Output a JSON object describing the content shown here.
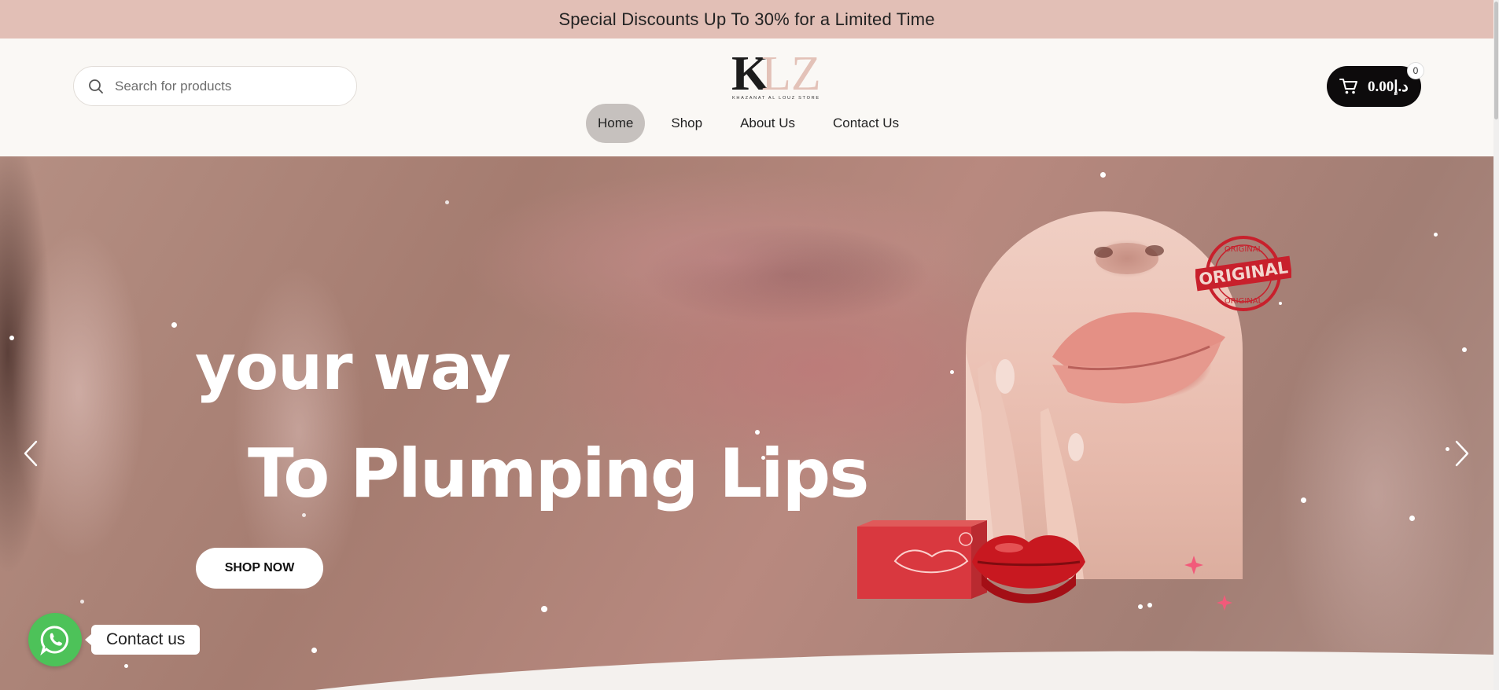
{
  "promo": {
    "text": "Special Discounts Up To 30% for a Limited Time"
  },
  "header": {
    "search_placeholder": "Search for products",
    "logo_text": "KLZ",
    "logo_tagline": "KHAZANAT AL LOUZ STORE",
    "nav": [
      {
        "label": "Home",
        "active": true
      },
      {
        "label": "Shop",
        "active": false
      },
      {
        "label": "About Us",
        "active": false
      },
      {
        "label": "Contact Us",
        "active": false
      }
    ],
    "cart": {
      "amount": "0.00د.إ",
      "count": "0"
    }
  },
  "hero": {
    "line1": "your way",
    "line2": "To Plumping Lips",
    "cta": "SHOP NOW",
    "stamp_text": "ORIGINAL",
    "icons": {
      "prev": "chevron-left-icon",
      "next": "chevron-right-icon"
    }
  },
  "widget": {
    "contact_label": "Contact us",
    "icon": "whatsapp-icon"
  },
  "colors": {
    "promo_bg": "#e2bfb6",
    "cart_bg": "#0d0b0c",
    "whatsapp": "#4dc259",
    "header_bg": "#faf8f5"
  }
}
